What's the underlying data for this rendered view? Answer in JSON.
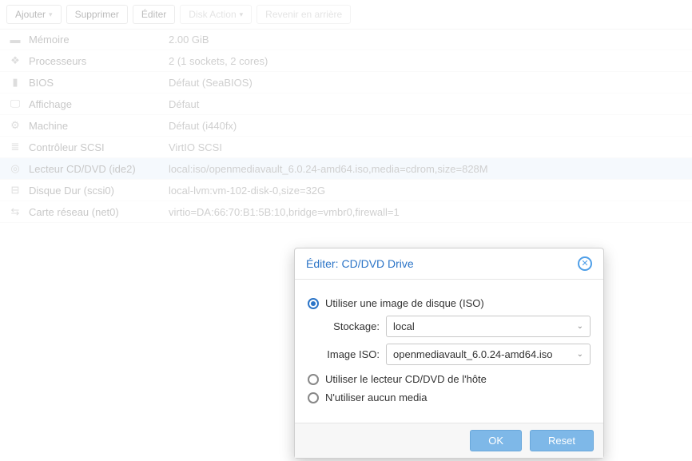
{
  "toolbar": {
    "add": "Ajouter",
    "remove": "Supprimer",
    "edit": "Éditer",
    "disk_action": "Disk Action",
    "revert": "Revenir en arrière"
  },
  "hardware": [
    {
      "icon": "memory-icon",
      "glyph": "▬",
      "name": "Mémoire",
      "value": "2.00 GiB"
    },
    {
      "icon": "cpu-icon",
      "glyph": "❖",
      "name": "Processeurs",
      "value": "2 (1 sockets, 2 cores)"
    },
    {
      "icon": "bios-icon",
      "glyph": "▮",
      "name": "BIOS",
      "value": "Défaut (SeaBIOS)"
    },
    {
      "icon": "display-icon",
      "glyph": "🖵",
      "name": "Affichage",
      "value": "Défaut"
    },
    {
      "icon": "machine-icon",
      "glyph": "⚙",
      "name": "Machine",
      "value": "Défaut (i440fx)"
    },
    {
      "icon": "scsi-icon",
      "glyph": "≣",
      "name": "Contrôleur SCSI",
      "value": "VirtIO SCSI"
    },
    {
      "icon": "cd-icon",
      "glyph": "◎",
      "name": "Lecteur CD/DVD (ide2)",
      "value": "local:iso/openmediavault_6.0.24-amd64.iso,media=cdrom,size=828M",
      "selected": true
    },
    {
      "icon": "hdd-icon",
      "glyph": "⊟",
      "name": "Disque Dur (scsi0)",
      "value": "local-lvm:vm-102-disk-0,size=32G"
    },
    {
      "icon": "net-icon",
      "glyph": "⇆",
      "name": "Carte réseau (net0)",
      "value": "virtio=DA:66:70:B1:5B:10,bridge=vmbr0,firewall=1"
    }
  ],
  "dialog": {
    "title_prefix": "Éditer:",
    "title": "CD/DVD Drive",
    "radio_iso": "Utiliser une image de disque (ISO)",
    "radio_host": "Utiliser le lecteur CD/DVD de l'hôte",
    "radio_none": "N'utiliser aucun media",
    "storage_label": "Stockage:",
    "storage_value": "local",
    "iso_label": "Image ISO:",
    "iso_value": "openmediavault_6.0.24-amd64.iso",
    "ok": "OK",
    "reset": "Reset"
  }
}
